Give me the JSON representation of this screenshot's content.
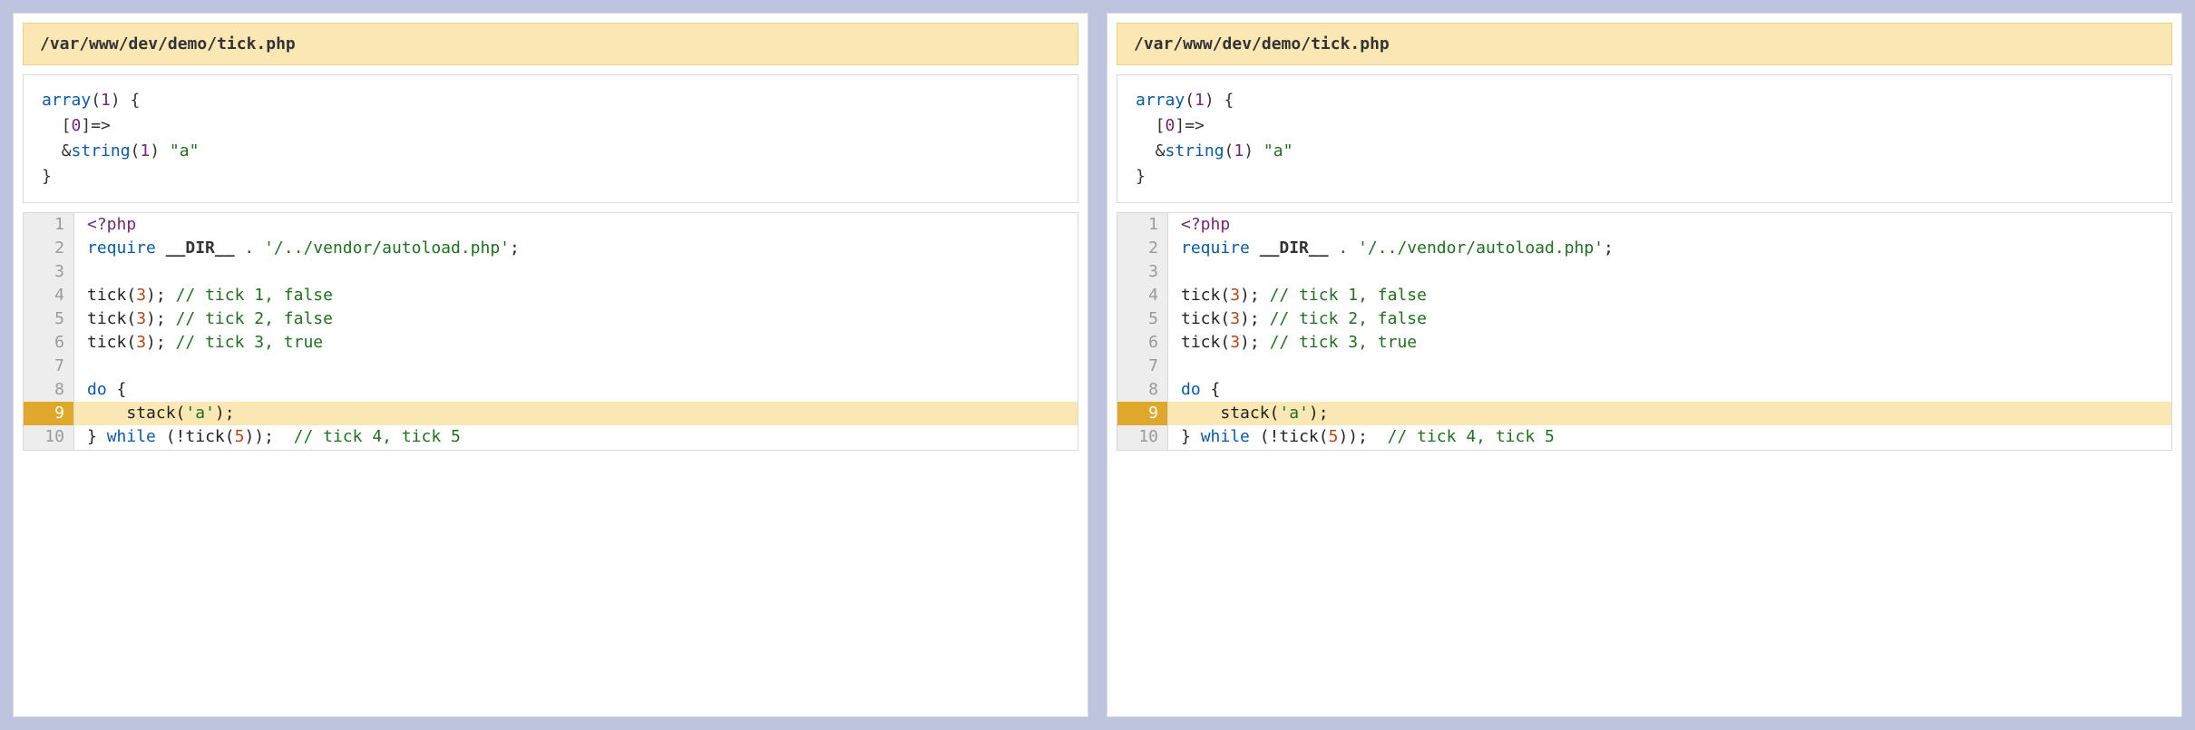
{
  "panels": [
    {
      "title": "/var/www/dev/demo/tick.php",
      "dump": {
        "keyword": "array",
        "count": "1",
        "index": "0",
        "type": "string",
        "len": "1",
        "value": "\"a\""
      },
      "code": {
        "highlight_line": 9,
        "lines": [
          {
            "n": "1",
            "kind": "open"
          },
          {
            "n": "2",
            "kind": "require",
            "path": "'/../vendor/autoload.php'"
          },
          {
            "n": "3",
            "kind": "blank"
          },
          {
            "n": "4",
            "kind": "tick",
            "arg": "3",
            "comment": "// tick 1, false"
          },
          {
            "n": "5",
            "kind": "tick",
            "arg": "3",
            "comment": "// tick 2, false"
          },
          {
            "n": "6",
            "kind": "tick",
            "arg": "3",
            "comment": "// tick 3, true"
          },
          {
            "n": "7",
            "kind": "blank"
          },
          {
            "n": "8",
            "kind": "do"
          },
          {
            "n": "9",
            "kind": "stack",
            "arg": "'a'"
          },
          {
            "n": "10",
            "kind": "while",
            "arg": "5",
            "comment": "// tick 4, tick 5"
          }
        ]
      }
    },
    {
      "title": "/var/www/dev/demo/tick.php",
      "dump": {
        "keyword": "array",
        "count": "1",
        "index": "0",
        "type": "string",
        "len": "1",
        "value": "\"a\""
      },
      "code": {
        "highlight_line": 9,
        "lines": [
          {
            "n": "1",
            "kind": "open"
          },
          {
            "n": "2",
            "kind": "require",
            "path": "'/../vendor/autoload.php'"
          },
          {
            "n": "3",
            "kind": "blank"
          },
          {
            "n": "4",
            "kind": "tick",
            "arg": "3",
            "comment": "// tick 1, false"
          },
          {
            "n": "5",
            "kind": "tick",
            "arg": "3",
            "comment": "// tick 2, false"
          },
          {
            "n": "6",
            "kind": "tick",
            "arg": "3",
            "comment": "// tick 3, true"
          },
          {
            "n": "7",
            "kind": "blank"
          },
          {
            "n": "8",
            "kind": "do"
          },
          {
            "n": "9",
            "kind": "stack",
            "arg": "'a'"
          },
          {
            "n": "10",
            "kind": "while",
            "arg": "5",
            "comment": "// tick 4, tick 5"
          }
        ]
      }
    }
  ]
}
